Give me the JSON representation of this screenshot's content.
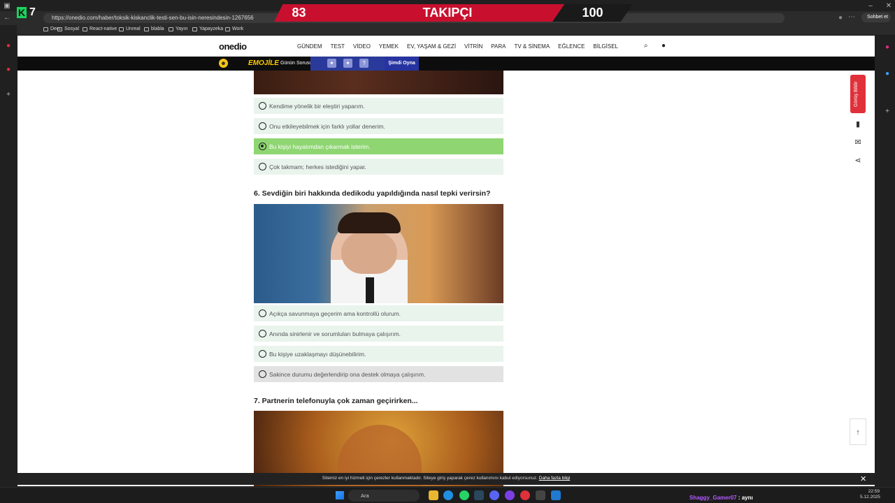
{
  "overlay": {
    "left_number": "83",
    "title": "TAKIPÇI",
    "right_number": "100",
    "channel_digit": "7"
  },
  "browser": {
    "url": "https://onedio.com/haber/toksik-kiskanclik-testi-sen-bu-isin-neresindesin-1267656",
    "bookmarks": [
      "Ders",
      "Sosyal",
      "React-native",
      "Unreal",
      "blabla",
      "Yayın",
      "Yapayzeka",
      "Work"
    ],
    "chat_button": "Sohbet et"
  },
  "site": {
    "logo": "onedio",
    "nav": [
      "GÜNDEM",
      "TEST",
      "VİDEO",
      "YEMEK",
      "EV, YAŞAM & GEZİ",
      "VİTRİN",
      "PARA",
      "TV & SİNEMA",
      "EĞLENCE",
      "BİLGİSEL"
    ]
  },
  "promo": {
    "game_logo": "EMOJİLE",
    "daily_question": "Günün Sorusu",
    "tile_question": "?",
    "play_now": "Şimdi Oyna"
  },
  "quiz": {
    "q5_options": [
      {
        "text": "Kendime yönelik bir eleştiri yaparım.",
        "selected": false
      },
      {
        "text": "Onu etkileyebilmek için farklı yollar denerim.",
        "selected": false
      },
      {
        "text": "Bu kişiyi hayatımdan çıkarmak isterim.",
        "selected": true
      },
      {
        "text": "Çok takmam; herkes istediğini yapar.",
        "selected": false
      }
    ],
    "q6_title": "6. Sevdiğin biri hakkında dedikodu yapıldığında nasıl tepki verirsin?",
    "q6_options": [
      {
        "text": "Açıkça savunmaya geçerim ama kontrollü olurum.",
        "selected": false
      },
      {
        "text": "Anında sinirlenir ve sorumluları bulmaya çalışırım.",
        "selected": false
      },
      {
        "text": "Bu kişiye uzaklaşmayı düşünebilirim.",
        "selected": false
      },
      {
        "text": "Sakince durumu değerlendirip ona destek olmaya çalışırım.",
        "selected": false
      }
    ],
    "q7_title": "7. Partnerin telefonuyla çok zaman geçirirken..."
  },
  "side": {
    "report": "Görüş Bildir"
  },
  "cookie": {
    "text": "Sitemiz en iyi hizmeti için çerezler kullanmaktadır. Siteye giriş yaparak çerez kullanımını kabul ediyorsunuz.",
    "link": "Daha fazla bilgi"
  },
  "taskbar": {
    "search": "Ara",
    "chat_user": "Shaggy_Gamer07",
    "chat_msg": ": aynı",
    "time": "22:59",
    "date": "5.12.2025"
  }
}
